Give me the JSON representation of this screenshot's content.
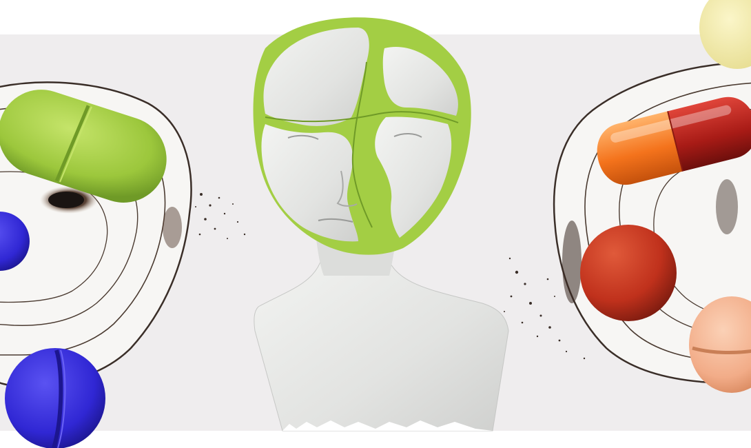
{
  "image": {
    "background_color": "#ffffff",
    "band_color": "#efedee",
    "colors": {
      "green_pill": "#a6cf45",
      "blue_pill": "#3a2fd9",
      "red_capsule": "#b8201a",
      "orange_capsule": "#f47a1f",
      "red_tablet": "#c3321d",
      "peach_tablet": "#f2b08e",
      "yellow_pill": "#f0eaa8",
      "plaster": "#e7e8e6",
      "burn": "#2a2320"
    }
  }
}
